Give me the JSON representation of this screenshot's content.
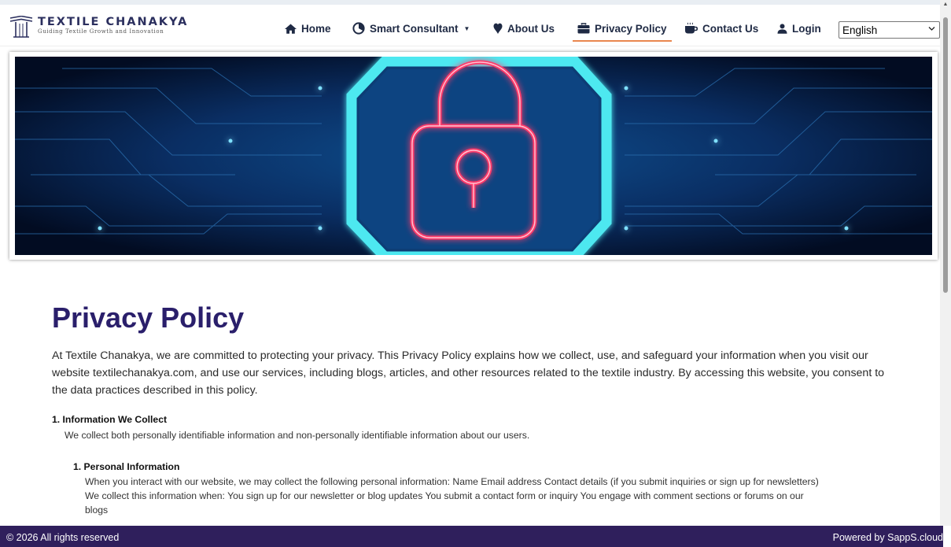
{
  "brand": {
    "name": "TEXTILE CHANAKYA",
    "tagline": "Guiding Textile Growth and Innovation"
  },
  "nav": {
    "home": "Home",
    "smart_consultant": "Smart Consultant",
    "about": "About Us",
    "privacy": "Privacy Policy",
    "contact": "Contact Us",
    "login": "Login",
    "active_item": "Privacy Policy"
  },
  "language": {
    "selected": "English"
  },
  "hero": {
    "image_icon": "neon-padlock-circuit-icon"
  },
  "content": {
    "title": "Privacy Policy",
    "intro": "At Textile Chanakya, we are committed to protecting your privacy. This Privacy Policy explains how we collect, use, and safeguard your information when you visit our website textilechanakya.com, and use our services, including blogs, articles, and other resources related to the textile industry. By accessing this website, you consent to the data practices described in this policy.",
    "section1_heading": "1. Information We Collect",
    "section1_text": "We collect both personally identifiable information and non-personally identifiable information about our users.",
    "sub1_heading": "1. Personal Information",
    "sub1_line1": "When you interact with our website, we may collect the following personal information: Name Email address Contact details (if you submit inquiries or sign up for newsletters)",
    "sub1_line2": "We collect this information when: You sign up for our newsletter or blog updates You submit a contact form or inquiry You engage with comment sections or forums on our",
    "sub1_line3": "blogs"
  },
  "footer": {
    "copyright": "© 2026 All rights reserved",
    "powered": "Powered by SappS.cloud"
  },
  "colors": {
    "brand_dark": "#2b2f5e",
    "title_purple": "#2a1f6b",
    "footer_bg": "#2f1f5c",
    "active_underline": "#e9874e",
    "neon_cyan": "#4ee8f0",
    "neon_red": "#ff3a6a"
  }
}
